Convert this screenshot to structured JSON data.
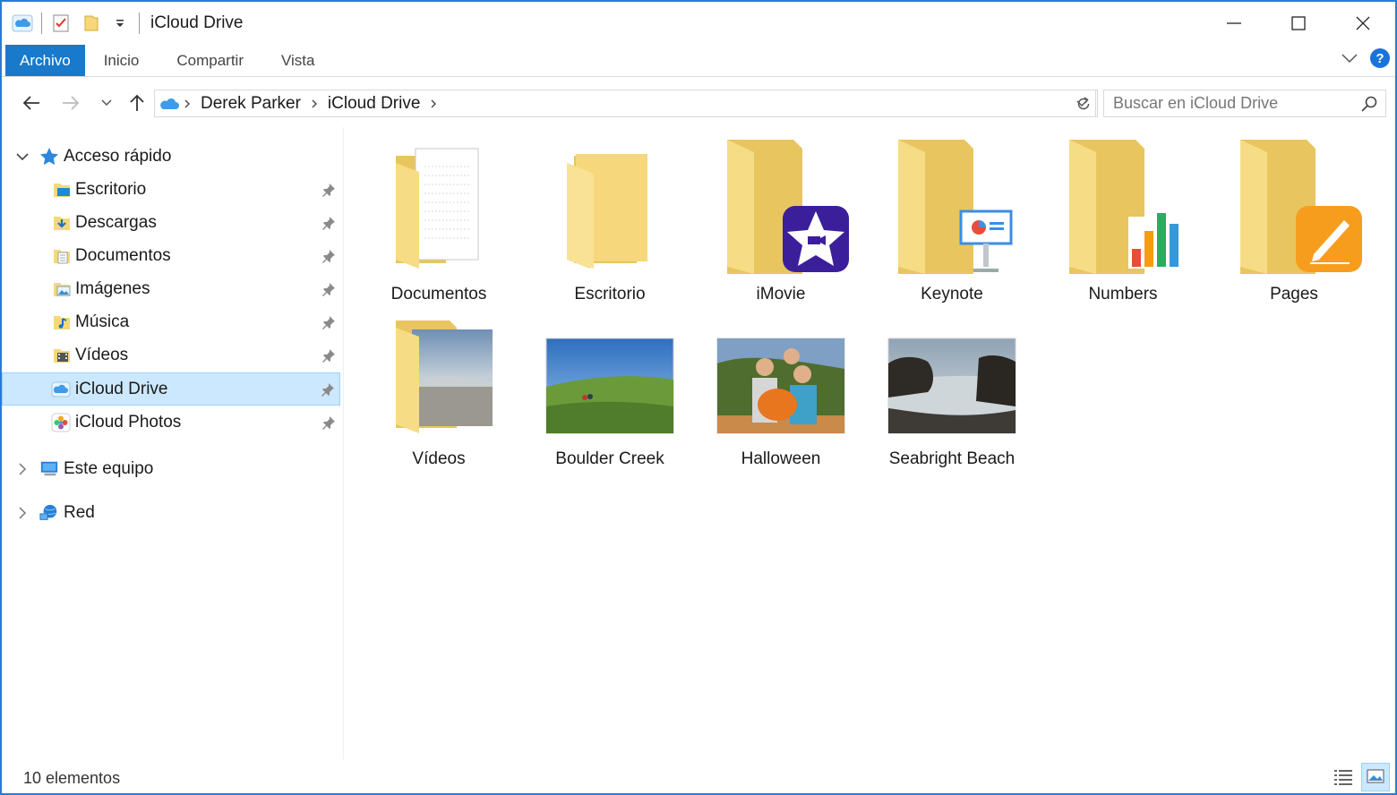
{
  "window": {
    "title": "iCloud Drive",
    "controls": [
      "minimize",
      "maximize",
      "close"
    ]
  },
  "ribbon": {
    "tabs": [
      {
        "label": "Archivo",
        "active": true
      },
      {
        "label": "Inicio"
      },
      {
        "label": "Compartir"
      },
      {
        "label": "Vista"
      }
    ],
    "help_label": "?"
  },
  "address": {
    "breadcrumbs": [
      "Derek Parker",
      "iCloud Drive"
    ],
    "search_placeholder": "Buscar en iCloud Drive"
  },
  "sidebar": {
    "quick_access": "Acceso rápido",
    "items": [
      {
        "label": "Escritorio",
        "icon": "desktop-folder-icon",
        "pinned": true
      },
      {
        "label": "Descargas",
        "icon": "downloads-folder-icon",
        "pinned": true
      },
      {
        "label": "Documentos",
        "icon": "documents-folder-icon",
        "pinned": true
      },
      {
        "label": "Imágenes",
        "icon": "pictures-folder-icon",
        "pinned": true
      },
      {
        "label": "Música",
        "icon": "music-folder-icon",
        "pinned": true
      },
      {
        "label": "Vídeos",
        "icon": "videos-folder-icon",
        "pinned": true
      },
      {
        "label": "iCloud Drive",
        "icon": "icloud-icon",
        "pinned": true,
        "selected": true
      },
      {
        "label": "iCloud Photos",
        "icon": "icloud-photos-icon",
        "pinned": true
      }
    ],
    "this_pc": "Este equipo",
    "network": "Red"
  },
  "content": {
    "items": [
      {
        "name": "Documentos",
        "kind": "folder-doc"
      },
      {
        "name": "Escritorio",
        "kind": "folder"
      },
      {
        "name": "iMovie",
        "kind": "folder-imovie"
      },
      {
        "name": "Keynote",
        "kind": "folder-keynote"
      },
      {
        "name": "Numbers",
        "kind": "folder-numbers"
      },
      {
        "name": "Pages",
        "kind": "folder-pages"
      },
      {
        "name": "Vídeos",
        "kind": "folder-photo"
      },
      {
        "name": "Boulder Creek",
        "kind": "image"
      },
      {
        "name": "Halloween",
        "kind": "image"
      },
      {
        "name": "Seabright Beach",
        "kind": "image"
      }
    ]
  },
  "status": {
    "count": "10 elementos"
  },
  "colors": {
    "accent": "#1979ca",
    "selection": "#cce8ff",
    "folder": "#f6d77c"
  }
}
